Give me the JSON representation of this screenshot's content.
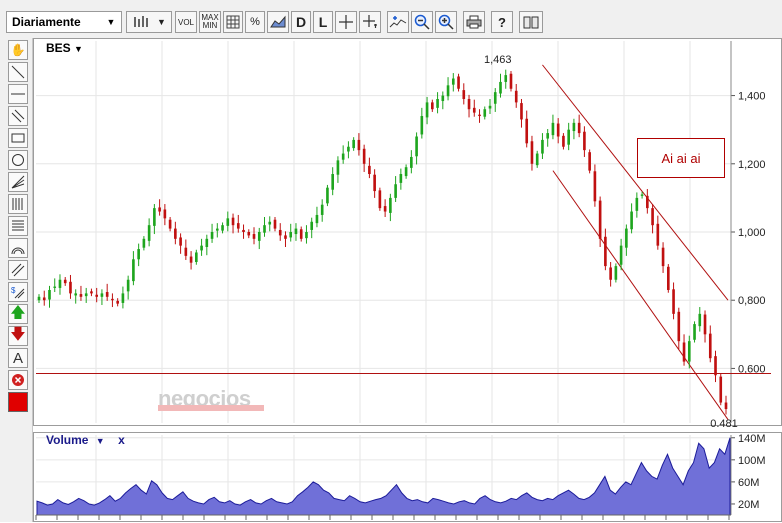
{
  "toolbar": {
    "period_label": "Diariamente",
    "vol_label": "VOL",
    "maxmin_label": "MAX\nMIN",
    "percent_label": "%",
    "d_label": "D",
    "l_label": "L",
    "help_label": "?"
  },
  "price_panel": {
    "symbol": "BES",
    "high_label": "1,463",
    "low_label": "0,481",
    "annotation": "Ai ai ai",
    "watermark": "negocios"
  },
  "volume_panel": {
    "title": "Volume",
    "close_symbol": "x"
  },
  "colors": {
    "up_candle": "#1ea51e",
    "down_candle": "#c01010",
    "trend_line": "#b01010",
    "volume_fill": "#7070d8",
    "volume_line": "#1c1c9a"
  },
  "chart_data": [
    {
      "type": "line",
      "title": "BES",
      "series": [
        {
          "values": [
            0.81,
            0.8,
            0.83,
            0.84,
            0.86,
            0.85,
            0.82,
            0.82,
            0.81,
            0.82,
            0.82,
            0.81,
            0.82,
            0.81,
            0.8,
            0.79,
            0.82,
            0.86,
            0.92,
            0.95,
            0.98,
            1.02,
            1.07,
            1.06,
            1.04,
            1.01,
            0.98,
            0.96,
            0.93,
            0.91,
            0.94,
            0.96,
            0.98,
            1.0,
            1.01,
            1.02,
            1.04,
            1.02,
            1.01,
            1.0,
            0.99,
            0.98,
            1.0,
            1.02,
            1.03,
            1.01,
            0.99,
            0.98,
            1.0,
            1.01,
            0.98,
            1.0,
            1.03,
            1.05,
            1.08,
            1.13,
            1.17,
            1.21,
            1.23,
            1.25,
            1.27,
            1.24,
            1.2,
            1.17,
            1.12,
            1.07,
            1.06,
            1.1,
            1.14,
            1.17,
            1.19,
            1.22,
            1.28,
            1.34,
            1.38,
            1.36,
            1.39,
            1.4,
            1.43,
            1.45,
            1.42,
            1.39,
            1.36,
            1.35,
            1.34,
            1.36,
            1.37,
            1.41,
            1.44,
            1.46,
            1.42,
            1.38,
            1.33,
            1.26,
            1.2,
            1.23,
            1.27,
            1.29,
            1.32,
            1.28,
            1.25,
            1.3,
            1.32,
            1.29,
            1.24,
            1.18,
            1.09,
            0.98,
            0.9,
            0.86,
            0.9,
            0.96,
            1.01,
            1.06,
            1.1,
            1.11,
            1.07,
            1.02,
            0.96,
            0.9,
            0.83,
            0.76,
            0.68,
            0.62,
            0.68,
            0.73,
            0.76,
            0.7,
            0.63,
            0.58,
            0.5,
            0.481
          ]
        }
      ],
      "ylim": [
        0.44,
        1.56
      ],
      "yticks": [
        "0,600",
        "0,800",
        "1,000",
        "1,200",
        "1,400"
      ],
      "annotations": [
        "1,463",
        "0,481",
        "Ai ai ai"
      ],
      "grid": true
    },
    {
      "type": "area",
      "title": "Volume",
      "series": [
        {
          "values": [
            25,
            22,
            18,
            20,
            28,
            22,
            19,
            24,
            30,
            26,
            20,
            18,
            22,
            28,
            35,
            25,
            30,
            40,
            48,
            55,
            45,
            38,
            62,
            55,
            40,
            30,
            28,
            35,
            42,
            30,
            25,
            22,
            20,
            28,
            32,
            24,
            22,
            26,
            20,
            18,
            24,
            28,
            22,
            20,
            26,
            30,
            24,
            22,
            20,
            24,
            35,
            42,
            50,
            60,
            55,
            45,
            40,
            30,
            28,
            26,
            35,
            30,
            24,
            22,
            25,
            28,
            30,
            35,
            45,
            55,
            40,
            30,
            26,
            28,
            24,
            22,
            30,
            28,
            25,
            22,
            20,
            24,
            26,
            22,
            20,
            30,
            35,
            28,
            24,
            22,
            25,
            30,
            28,
            35,
            40,
            32,
            28,
            26,
            30,
            28,
            35,
            40,
            45,
            38,
            30,
            28,
            32,
            40,
            55,
            70,
            45,
            38,
            50,
            60,
            55,
            75,
            95,
            80,
            70,
            65,
            90,
            110,
            85,
            70,
            55,
            80,
            95,
            130,
            120,
            85,
            95,
            120,
            110,
            140
          ]
        }
      ],
      "ylim": [
        0,
        145
      ],
      "yticks": [
        "20M",
        "60M",
        "100M",
        "140M"
      ],
      "grid": true
    }
  ]
}
